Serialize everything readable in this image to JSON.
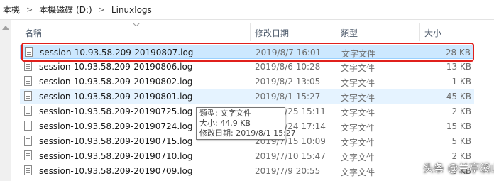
{
  "breadcrumb": [
    "本機",
    "本機磁碟 (D:)",
    "Linuxlogs"
  ],
  "columns": {
    "name": "名稱",
    "date": "修改日期",
    "type": "類型",
    "size": "大小"
  },
  "files": [
    {
      "name": "session-10.93.58.209-20190807.log",
      "date": "2019/8/7 16:01",
      "type": "文字文件",
      "size": "28 KB"
    },
    {
      "name": "session-10.93.58.209-20190806.log",
      "date": "2019/8/6 10:28",
      "type": "文字文件",
      "size": "13 KB"
    },
    {
      "name": "session-10.93.58.209-20190802.log",
      "date": "2019/8/2 13:05",
      "type": "文字文件",
      "size": "1 KB"
    },
    {
      "name": "session-10.93.58.209-20190801.log",
      "date": "2019/8/1 15:27",
      "type": "文字文件",
      "size": "45 KB"
    },
    {
      "name": "session-10.93.58.209-20190725.log",
      "date": "2019/7/25 15:11",
      "type": "文字文件",
      "size": "2 KB"
    },
    {
      "name": "session-10.93.58.209-20190724.log",
      "date": "2019/7/24 17:14",
      "type": "文字文件",
      "size": "15 KB"
    },
    {
      "name": "session-10.93.58.209-20190715.log",
      "date": "2019/7/15 10:09",
      "type": "文字文件",
      "size": "5 KB"
    },
    {
      "name": "session-10.93.58.209-20190710.log",
      "date": "2019/7/10 15:47",
      "type": "文字文件",
      "size": "2 KB"
    },
    {
      "name": "session-10.93.58.209-20190709.log",
      "date": "2019/7/9 20:55",
      "type": "文字文件",
      "size": "3 KB"
    }
  ],
  "tooltip": {
    "type_line": "類型: 文字文件",
    "size_line": "大小: 44.9 KB",
    "date_line": "修改日期: 2019/8/1 15:27"
  },
  "watermark": "头条 @兰亭溪山",
  "colors": {
    "selected_bg": "#cce8ff",
    "hover_bg": "#e5f3ff",
    "highlight_border": "#e0201c"
  }
}
